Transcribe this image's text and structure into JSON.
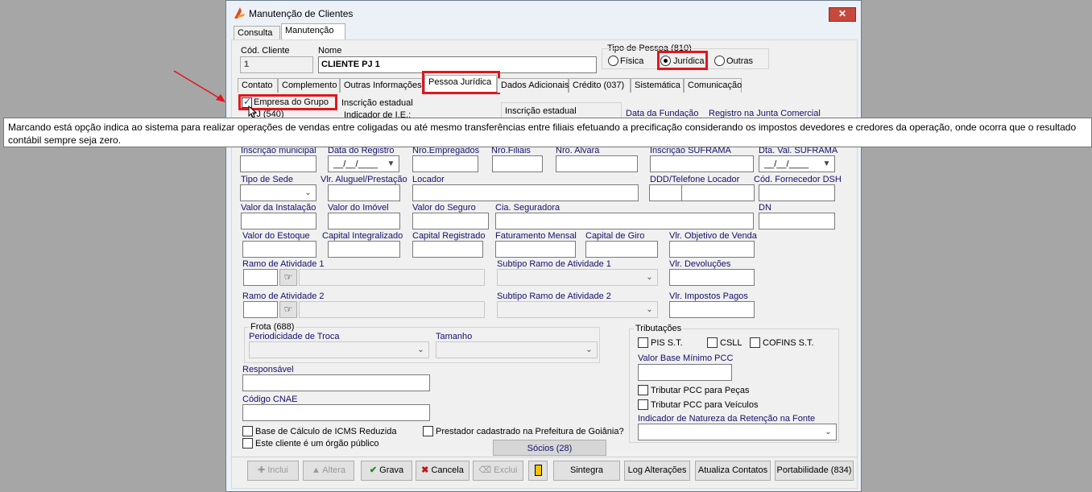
{
  "window": {
    "title": "Manutenção de Clientes",
    "close_label": "✕"
  },
  "main_tabs": [
    "Consulta",
    "Manutenção"
  ],
  "header": {
    "cod_label": "Cód. Cliente",
    "cod_value": "1",
    "nome_label": "Nome",
    "nome_value": "CLIENTE PJ 1",
    "tipo_label": "Tipo de Pessoa (810)",
    "tipo_options": [
      "Física",
      "Jurídica",
      "Outras"
    ],
    "tipo_selected": "Jurídica"
  },
  "sub_tabs": [
    "Contato",
    "Complemento",
    "Outras Informações",
    "Pessoa Jurídica",
    "Dados Adicionais",
    "Crédito (037)",
    "Sistemática",
    "Comunicação"
  ],
  "pj": {
    "empresa_grupo": "Empresa do Grupo",
    "empresa_grupo_checked": true,
    "pj_label": "PJ (540)",
    "inscricao_estadual_1": "Inscrição estadual",
    "indicador_ie": "Indicador de I.E.:",
    "inscricao_estadual_2": "Inscrição estadual",
    "data_fundacao": "Data da Fundação",
    "registro_junta": "Registro na Junta Comercial"
  },
  "tooltip": "Marcando está opção indica ao sistema para realizar operações de vendas entre coligadas ou até mesmo transferências entre filiais efetuando a precificação considerando os impostos devedores e credores da operação, onde ocorra que o resultado contábil sempre seja zero.",
  "labels": {
    "inscricao_municipal": "Inscrição municipal",
    "data_registro": "Data do Registro",
    "nro_empregados": "Nro.Empregados",
    "nro_filiais": "Nro.Filiais",
    "nro_alvara": "Nro. Alvará",
    "inscricao_suframa": "Inscrição SUFRAMA",
    "dta_val_suframa": "Dta. Val. SUFRAMA",
    "tipo_sede": "Tipo de Sede",
    "vlr_aluguel": "Vlr. Aluguel/Prestação",
    "locador": "Locador",
    "ddd_tel_locador": "DDD/Telefone Locador",
    "cod_fornecedor_dsh": "Cód. Fornecedor DSH",
    "valor_instalacao": "Valor da Instalação",
    "valor_imovel": "Valor do Imóvel",
    "valor_seguro": "Valor do Seguro",
    "cia_seguradora": "Cia. Seguradora",
    "dn": "DN",
    "valor_estoque": "Valor do Estoque",
    "capital_integralizado": "Capital Integralizado",
    "capital_registrado": "Capital Registrado",
    "faturamento_mensal": "Faturamento Mensal",
    "capital_giro": "Capital de Giro",
    "vlr_objetivo_venda": "Vlr. Objetivo de Venda",
    "ramo_atividade_1": "Ramo de Atividade 1",
    "subtipo_ramo_1": "Subtipo Ramo de Atividade 1",
    "vlr_devolucoes": "Vlr. Devoluções",
    "ramo_atividade_2": "Ramo de Atividade 2",
    "subtipo_ramo_2": "Subtipo Ramo de Atividade 2",
    "vlr_impostos_pagos": "Vlr. Impostos Pagos",
    "frota": "Frota (688)",
    "periodicidade_troca": "Periodicidade de Troca",
    "tamanho": "Tamanho",
    "responsavel": "Responsável",
    "codigo_cnae": "Código CNAE",
    "tributacoes": "Tributações",
    "pis_st": "PIS S.T.",
    "csll": "CSLL",
    "cofins_st": "COFINS S.T.",
    "valor_base_pcc": "Valor Base Mínimo PCC",
    "tributar_pcc_pecas": "Tributar PCC para Peças",
    "tributar_pcc_veiculos": "Tributar PCC para Veículos",
    "indicador_natureza": "Indicador de Natureza da Retenção na Fonte",
    "base_icms_reduzida": "Base de Cálculo de ICMS Reduzida",
    "prestador_goiania": "Prestador cadastrado na Prefeitura de Goiânia?",
    "orgao_publico": "Este cliente é um órgão público",
    "socios": "Sócios (28)"
  },
  "date_placeholder": "__/__/____",
  "toolbar": {
    "inclui": "Inclui",
    "altera": "Altera",
    "grava": "Grava",
    "cancela": "Cancela",
    "exclui": "Exclui",
    "sintegra": "Sintegra",
    "log": "Log Alterações",
    "atualiza": "Atualiza Contatos",
    "portabilidade": "Portabilidade (834)"
  },
  "colors": {
    "highlight": "#e0161c",
    "label_blue": "#13106a",
    "grava_green": "#1a8a1a",
    "cancela_red": "#c0141a"
  }
}
